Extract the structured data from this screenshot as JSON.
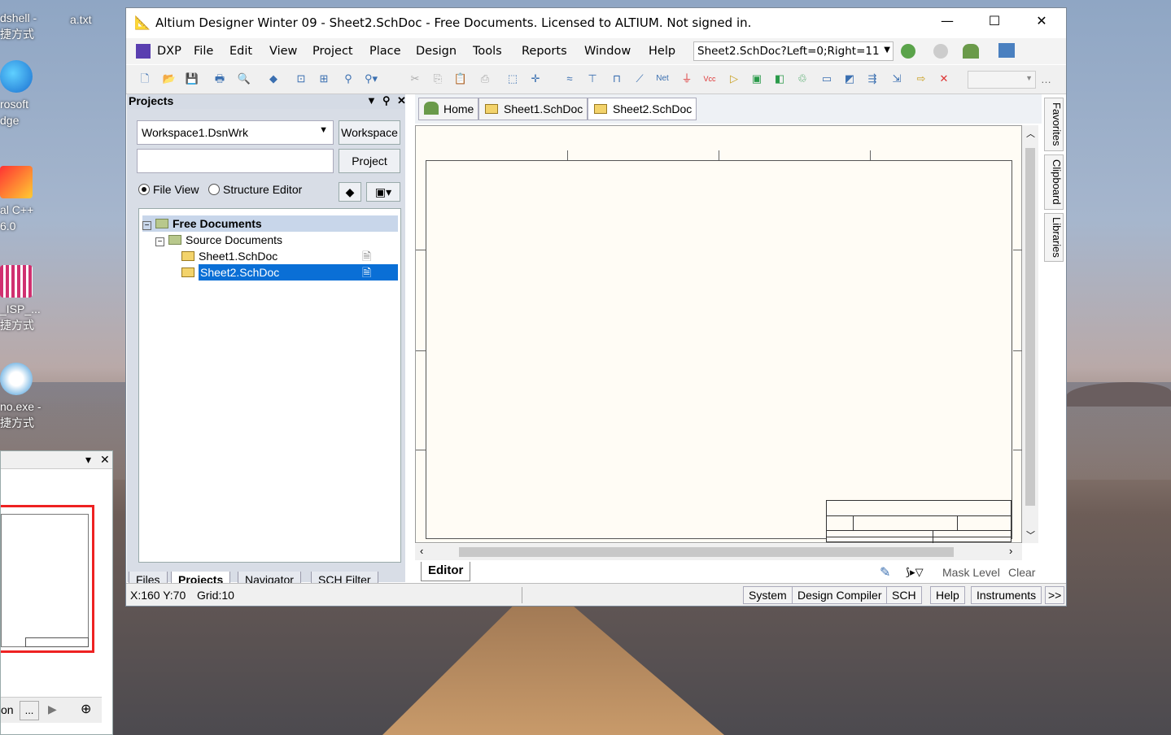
{
  "desktop": {
    "icons": [
      {
        "label": "dshell -\n捷方式"
      },
      {
        "label": "rosoft\ndge"
      },
      {
        "label": "al C++\n6.0"
      },
      {
        "label": "_ISP_...\n捷方式"
      },
      {
        "label": "no.exe -\n捷方式"
      }
    ],
    "file_label": "a.txt"
  },
  "win2": {
    "bottom_left": "on",
    "bottom_btn": "..."
  },
  "window": {
    "title": "Altium Designer Winter 09 - Sheet2.SchDoc - Free Documents. Licensed to ALTIUM. Not signed in."
  },
  "menu": {
    "items": [
      "DXP",
      "File",
      "Edit",
      "View",
      "Project",
      "Place",
      "Design",
      "Tools",
      "Reports",
      "Window",
      "Help"
    ],
    "address": "Sheet2.SchDoc?Left=0;Right=11"
  },
  "projects": {
    "header": "Projects",
    "workspace_value": "Workspace1.DsnWrk",
    "workspace_btn": "Workspace",
    "project_btn": "Project",
    "radio_file": "File View",
    "radio_struct": "Structure Editor",
    "tree": {
      "root": "Free Documents",
      "folder": "Source Documents",
      "docs": [
        "Sheet1.SchDoc",
        "Sheet2.SchDoc"
      ]
    },
    "tabs": [
      "Files",
      "Projects",
      "Navigator",
      "SCH Filter"
    ]
  },
  "doctabs": {
    "home": "Home",
    "tabs": [
      "Sheet1.SchDoc",
      "Sheet2.SchDoc"
    ]
  },
  "editor": {
    "tab": "Editor",
    "mask_level": "Mask Level",
    "clear": "Clear"
  },
  "sidebar": {
    "tabs": [
      "Favorites",
      "Clipboard",
      "Libraries"
    ]
  },
  "status": {
    "coords": "X:160 Y:70",
    "grid": "Grid:10",
    "buttons": [
      "System",
      "Design Compiler",
      "SCH",
      "Help",
      "Instruments"
    ],
    "more": ">>"
  }
}
